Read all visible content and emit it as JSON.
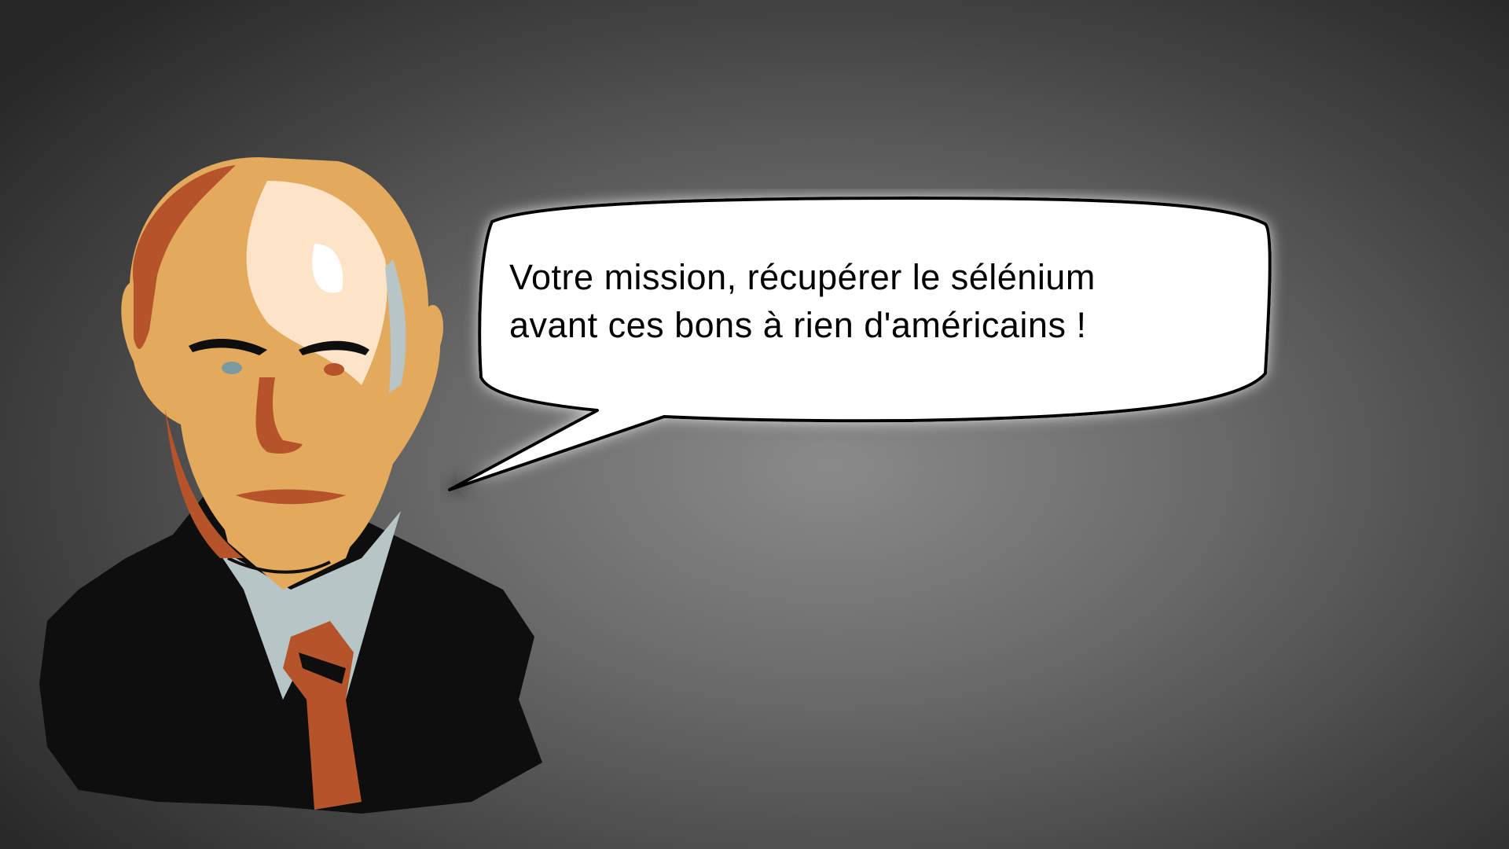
{
  "slide": {
    "speech_bubble": {
      "lines": [
        "Votre mission, récupérer le sélénium",
        "avant ces bons à rien d'américains !"
      ]
    },
    "portrait": {
      "description_icon": "stylized-man-portrait",
      "palette": {
        "skin_light": "#fde3c8",
        "skin_mid": "#e3a95c",
        "skin_dark": "#b5542a",
        "shadow": "#0e0e0e",
        "shirt": "#b7c5c7",
        "tie": "#b5542a"
      }
    },
    "background_color": "#6b6b6b"
  }
}
